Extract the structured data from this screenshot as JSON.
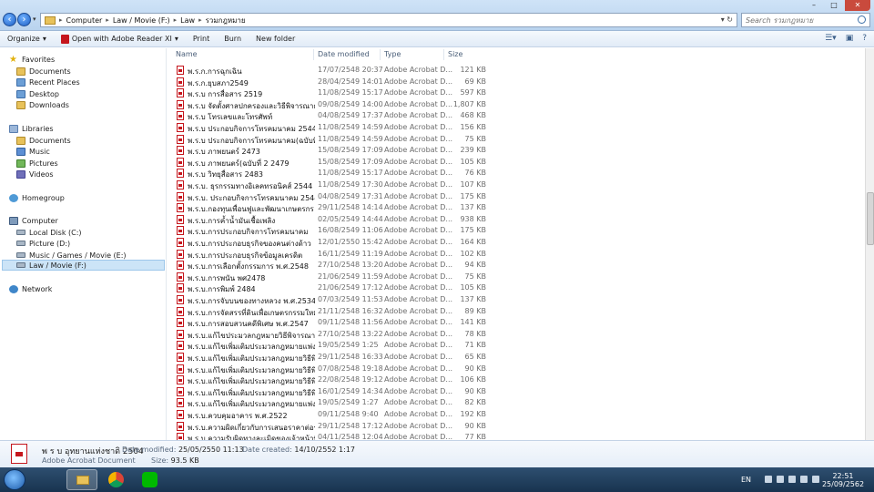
{
  "address": {
    "breadcrumbs": [
      "Computer",
      "Law / Movie (F:)",
      "Law",
      "รวมกฎหมาย"
    ]
  },
  "search": {
    "placeholder": "Search รวมกฎหมาย"
  },
  "toolbar": {
    "organize": "Organize",
    "open_with": "Open with Adobe Reader XI",
    "print": "Print",
    "burn": "Burn",
    "new_folder": "New folder"
  },
  "sidebar": {
    "favorites": "Favorites",
    "fav_items": [
      "Documents",
      "Recent Places",
      "Desktop",
      "Downloads"
    ],
    "libraries": "Libraries",
    "lib_items": [
      "Documents",
      "Music",
      "Pictures",
      "Videos"
    ],
    "homegroup": "Homegroup",
    "computer": "Computer",
    "drives": [
      "Local Disk (C:)",
      "Picture (D:)",
      "Music / Games / Movie (E:)",
      "Law / Movie (F:)"
    ],
    "network": "Network"
  },
  "columns": {
    "name": "Name",
    "date": "Date modified",
    "type": "Type",
    "size": "Size"
  },
  "files": [
    {
      "name": "พ.ร.ก.การฉุกเฉิน",
      "date": "17/07/2548 20:37",
      "type": "Adobe Acrobat D...",
      "size": "121 KB"
    },
    {
      "name": "พ.ร.ก.ยุบสภา2549",
      "date": "28/04/2549 14:01",
      "type": "Adobe Acrobat D...",
      "size": "69 KB"
    },
    {
      "name": "พ.ร.บ การสื่อสาร 2519",
      "date": "11/08/2549 15:17",
      "type": "Adobe Acrobat D...",
      "size": "597 KB"
    },
    {
      "name": "พ.ร.บ จัดตั้งศาลปกครองและวิธีพิจารณาการปก...",
      "date": "09/08/2549 14:00",
      "type": "Adobe Acrobat D...",
      "size": "1,807 KB"
    },
    {
      "name": "พ.ร.บ โทรเลขและโทรศัพท์",
      "date": "04/08/2549 17:37",
      "type": "Adobe Acrobat D...",
      "size": "468 KB"
    },
    {
      "name": "พ.ร.บ ประกอบกิจการโทรคมนาคม 2544",
      "date": "11/08/2549 14:59",
      "type": "Adobe Acrobat D...",
      "size": "156 KB"
    },
    {
      "name": "พ.ร.บ ประกอบกิจการโทรคมนาคม(ฉบับที่2) 2...",
      "date": "11/08/2549 14:59",
      "type": "Adobe Acrobat D...",
      "size": "75 KB"
    },
    {
      "name": "พ.ร.บ ภาพยนตร์ 2473",
      "date": "15/08/2549 17:09",
      "type": "Adobe Acrobat D...",
      "size": "239 KB"
    },
    {
      "name": "พ.ร.บ ภาพยนตร์(ฉบับที่ 2 2479",
      "date": "15/08/2549 17:09",
      "type": "Adobe Acrobat D...",
      "size": "105 KB"
    },
    {
      "name": "พ.ร.บ วิทยุสื่อสาร 2483",
      "date": "11/08/2549 15:17",
      "type": "Adobe Acrobat D...",
      "size": "76 KB"
    },
    {
      "name": "พ.ร.บ. ธุรกรรมทางอิเลคทรอนิคส์ 2544",
      "date": "11/08/2549 17:30",
      "type": "Adobe Acrobat D...",
      "size": "107 KB"
    },
    {
      "name": "พ.ร.บ. ประกอบกิจการโทรคมนาคม 2544",
      "date": "04/08/2549 17:31",
      "type": "Adobe Acrobat D...",
      "size": "175 KB"
    },
    {
      "name": "พ.ร.บ.กองทุนเพื่อนฟูและพัฒนาเกษตรกร",
      "date": "29/11/2548 14:14",
      "type": "Adobe Acrobat D...",
      "size": "137 KB"
    },
    {
      "name": "พ.ร.บ.การค้ำน้ำมันเชื้อเพลิง",
      "date": "02/05/2549 14:44",
      "type": "Adobe Acrobat D...",
      "size": "938 KB"
    },
    {
      "name": "พ.ร.บ.การประกอบกิจการโทรคมนาคม",
      "date": "16/08/2549 11:06",
      "type": "Adobe Acrobat D...",
      "size": "175 KB"
    },
    {
      "name": "พ.ร.บ.การประกอบธุรกิจของคนต่างด้าว",
      "date": "12/01/2550 15:42",
      "type": "Adobe Acrobat D...",
      "size": "164 KB"
    },
    {
      "name": "พ.ร.บ.การประกอบธุรกิจข้อมูลเครดิต",
      "date": "16/11/2549 11:19",
      "type": "Adobe Acrobat D...",
      "size": "102 KB"
    },
    {
      "name": "พ.ร.บ.การเลือกตั้งกรรมการ พ.ศ.2548",
      "date": "27/10/2548 13:20",
      "type": "Adobe Acrobat D...",
      "size": "94 KB"
    },
    {
      "name": "พ.ร.บ.การพนัน พศ2478",
      "date": "21/06/2549 11:59",
      "type": "Adobe Acrobat D...",
      "size": "75 KB"
    },
    {
      "name": "พ.ร.บ.การพิมพ์ 2484",
      "date": "21/06/2549 17:12",
      "type": "Adobe Acrobat D...",
      "size": "105 KB"
    },
    {
      "name": "พ.ร.บ.การจับบนของทางหลวง พ.ศ.2534",
      "date": "07/03/2549 11:53",
      "type": "Adobe Acrobat D...",
      "size": "137 KB"
    },
    {
      "name": "พ.ร.บ.การจัดสรรที่ดินเพื่อเกษตรกรรมใหม่",
      "date": "21/11/2548 16:32",
      "type": "Adobe Acrobat D...",
      "size": "89 KB"
    },
    {
      "name": "พ.ร.บ.การสอบสวนคดีพิเศษ พ.ศ.2547",
      "date": "09/11/2548 11:56",
      "type": "Adobe Acrobat D...",
      "size": "141 KB"
    },
    {
      "name": "พ.ร.บ.แก้ไขประมวลกฎหมายวิธีพิจารณาความอ...",
      "date": "27/10/2548 13:22",
      "type": "Adobe Acrobat D...",
      "size": "78 KB"
    },
    {
      "name": "พ.ร.บ.แก้ไขเพิ่มเติมประมวลกฎหมายแพ่ง (ล...",
      "date": "19/05/2549 1:25",
      "type": "Adobe Acrobat D...",
      "size": "71 KB"
    },
    {
      "name": "พ.ร.บ.แก้ไขเพิ่มเติมประมวลกฎหมายวิธีพิจาร...",
      "date": "29/11/2548 16:33",
      "type": "Adobe Acrobat D...",
      "size": "65 KB"
    },
    {
      "name": "พ.ร.บ.แก้ไขเพิ่มเติมประมวลกฎหมายวิธีพิจาร...",
      "date": "07/08/2548 19:18",
      "type": "Adobe Acrobat D...",
      "size": "90 KB"
    },
    {
      "name": "พ.ร.บ.แก้ไขเพิ่มเติมประมวลกฎหมายวิธีพิจาร...",
      "date": "22/08/2548 19:12",
      "type": "Adobe Acrobat D...",
      "size": "106 KB"
    },
    {
      "name": "พ.ร.บ.แก้ไขเพิ่มเติมประมวลกฎหมายวิธีพิจาร...",
      "date": "16/01/2549 14:34",
      "type": "Adobe Acrobat D...",
      "size": "90 KB"
    },
    {
      "name": "พ.ร.บ.แก้ไขเพิ่มเติมประมวลกฎหมายแพ่ง (ล...",
      "date": "19/05/2549 1:27",
      "type": "Adobe Acrobat D...",
      "size": "82 KB"
    },
    {
      "name": "พ.ร.บ.ควบคุมอาคาร พ.ศ.2522",
      "date": "09/11/2548 9:40",
      "type": "Adobe Acrobat D...",
      "size": "192 KB"
    },
    {
      "name": "พ.ร.บ.ความผิดเกี่ยวกับการเสนอราคาต่อรัฐ25...",
      "date": "29/11/2548 17:12",
      "type": "Adobe Acrobat D...",
      "size": "90 KB"
    },
    {
      "name": "พ.ร.บ.ความรับผิดทางละเมิดของเจ้าหน้าที่ พ.ศ...",
      "date": "04/11/2548 12:04",
      "type": "Adobe Acrobat D...",
      "size": "77 KB"
    }
  ],
  "details": {
    "filename": "พ ร บ อุทยานแห่งชาติ 2504",
    "filetype": "Adobe Acrobat Document",
    "modified_label": "Date modified:",
    "modified_value": "25/05/2550 11:13",
    "created_label": "Date created:",
    "created_value": "14/10/2552 1:17",
    "size_label": "Size:",
    "size_value": "93.5 KB"
  },
  "taskbar": {
    "lang": "EN",
    "time": "22:51",
    "date": "25/09/2562"
  }
}
